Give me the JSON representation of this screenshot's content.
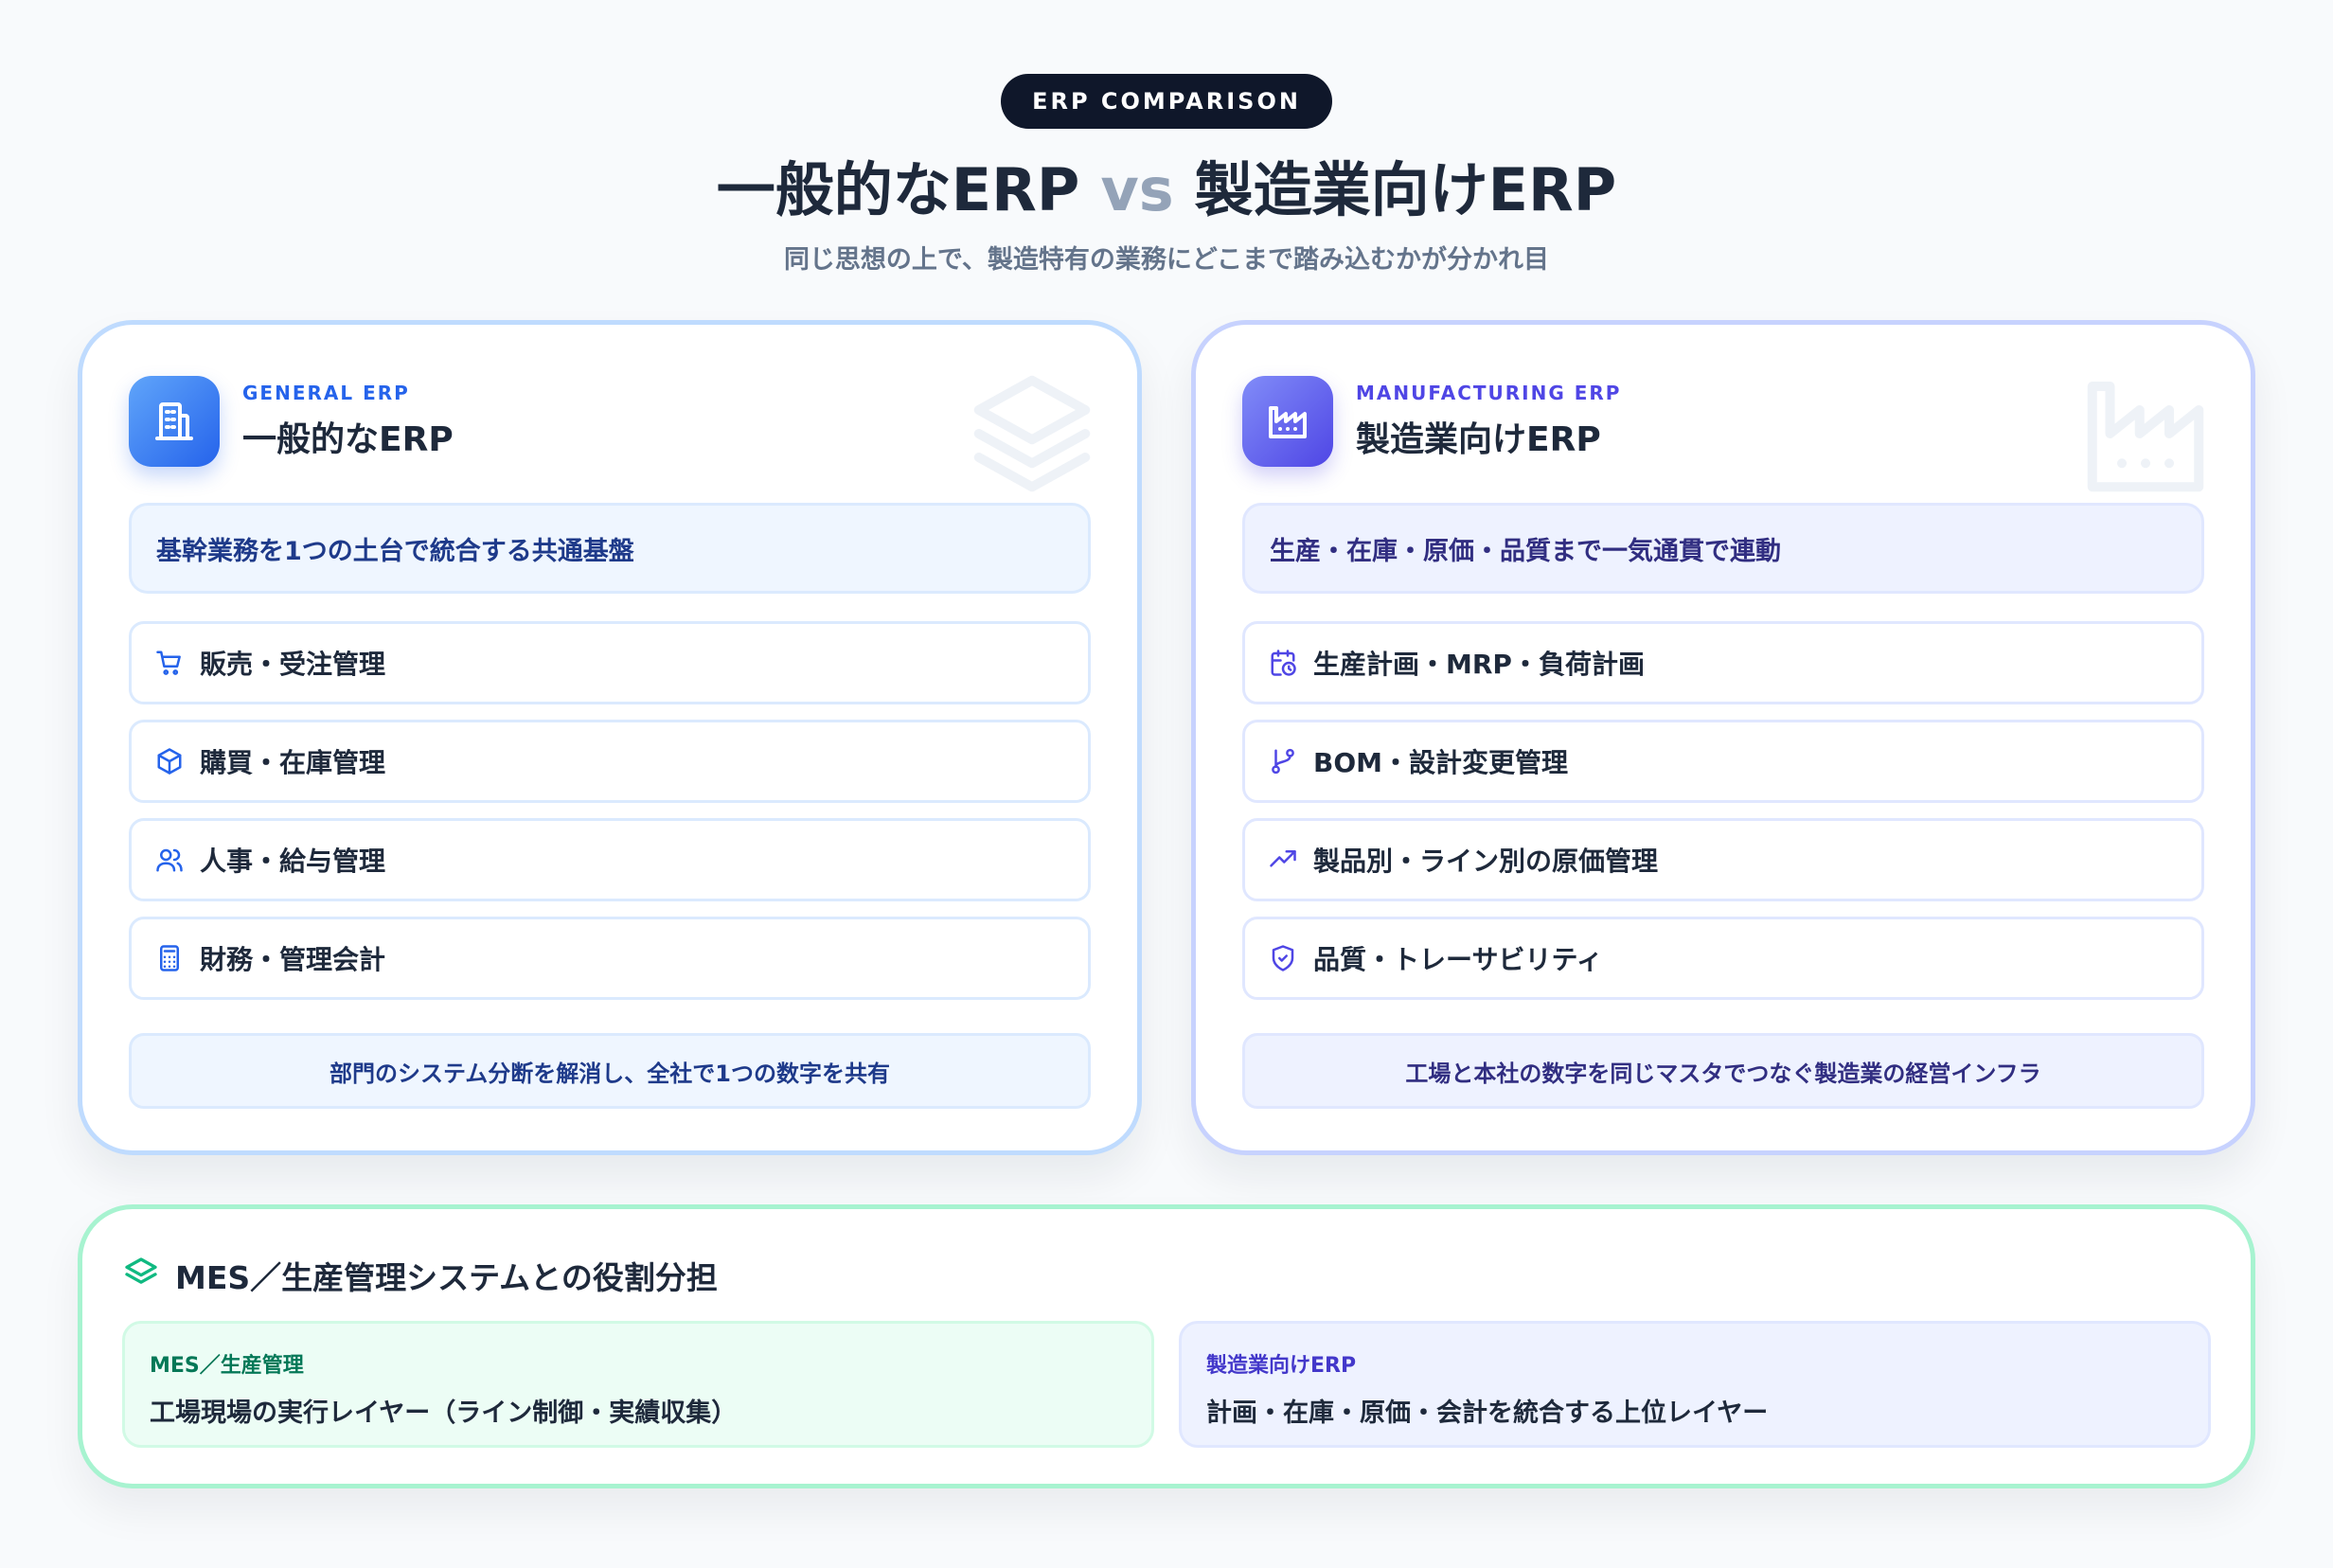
{
  "header": {
    "pill": "ERP COMPARISON",
    "title_left": "一般的なERP",
    "title_vs": "vs",
    "title_right": "製造業向けERP",
    "subtitle": "同じ思想の上で、製造特有の業務にどこまで踏み込むかが分かれ目"
  },
  "general": {
    "icon": "building-icon",
    "kicker": "GENERAL ERP",
    "title": "一般的なERP",
    "summary": "基幹業務を1つの土台で統合する共通基盤",
    "items": [
      {
        "icon": "cart-icon",
        "label": "販売・受注管理"
      },
      {
        "icon": "box-icon",
        "label": "購買・在庫管理"
      },
      {
        "icon": "users-icon",
        "label": "人事・給与管理"
      },
      {
        "icon": "calculator-icon",
        "label": "財務・管理会計"
      }
    ],
    "footer": "部門のシステム分断を解消し、全社で1つの数字を共有"
  },
  "mfg": {
    "icon": "factory-icon",
    "kicker": "MANUFACTURING ERP",
    "title": "製造業向けERP",
    "summary": "生産・在庫・原価・品質まで一気通貫で連動",
    "items": [
      {
        "icon": "calendar-clock-icon",
        "label": "生産計画・MRP・負荷計画"
      },
      {
        "icon": "git-branch-icon",
        "label": "BOM・設計変更管理"
      },
      {
        "icon": "trend-up-icon",
        "label": "製品別・ライン別の原価管理"
      },
      {
        "icon": "shield-check-icon",
        "label": "品質・トレーサビリティ"
      }
    ],
    "footer": "工場と本社の数字を同じマスタでつなぐ製造業の経営インフラ"
  },
  "roles": {
    "icon": "layers-icon",
    "title": "MES／生産管理システムとの役割分担",
    "mes": {
      "label": "MES／生産管理",
      "desc": "工場現場の実行レイヤー（ライン制御・実績収集）"
    },
    "erp": {
      "label": "製造業向けERP",
      "desc": "計画・在庫・原価・会計を統合する上位レイヤー"
    }
  },
  "colors": {
    "general_accent": "#2563eb",
    "mfg_accent": "#4f46e5",
    "roles_accent": "#10b981"
  }
}
